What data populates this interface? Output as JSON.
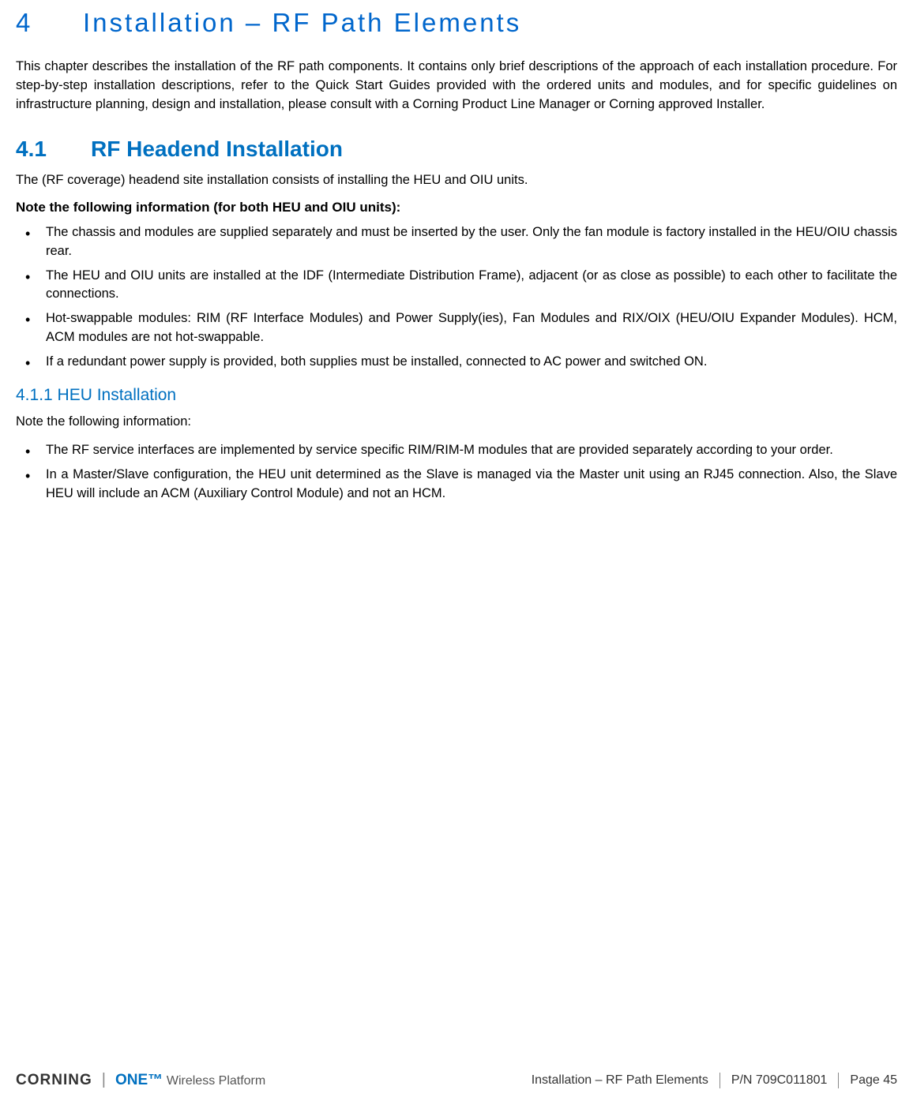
{
  "chapter": {
    "number": "4",
    "title": "Installation – RF Path Elements"
  },
  "intro": "This chapter describes the installation of the RF path components. It contains only brief descriptions of the approach of each installation procedure.   For step-by-step installation descriptions, refer to the Quick Start Guides provided with the ordered units and modules, and for specific guidelines on infrastructure planning, design and installation, please consult with a Corning Product Line Manager or Corning approved Installer.",
  "section41": {
    "number": "4.1",
    "title": "RF Headend Installation",
    "lead": "The (RF coverage) headend site installation consists of installing the HEU and OIU units.",
    "note_heading": "Note the following information (for both HEU and OIU units):",
    "bullets": [
      "The chassis and modules are supplied separately and must be inserted by the user. Only the fan module is factory installed in the HEU/OIU chassis rear.",
      "The HEU and OIU units are installed at the IDF (Intermediate Distribution Frame), adjacent (or as close as possible) to each other to facilitate the connections.",
      "Hot-swappable modules: RIM (RF Interface Modules) and Power Supply(ies), Fan Modules and RIX/OIX   (HEU/OIU Expander Modules). HCM, ACM modules are not hot-swappable.",
      "If a redundant power supply is provided, both supplies must be installed, connected to AC power and switched ON."
    ]
  },
  "section411": {
    "number_title": "4.1.1 HEU Installation",
    "lead": "Note the following information:",
    "bullets": [
      "The RF service interfaces are implemented by service specific RIM/RIM-M modules that are provided separately according to your order.",
      "In a Master/Slave configuration, the HEU unit determined as the Slave is managed via the Master unit using an RJ45 connection. Also, the Slave HEU will include an ACM (Auxiliary Control Module) and not an HCM."
    ]
  },
  "footer": {
    "brand_corning": "CORNING",
    "brand_one": "ONE™",
    "brand_tag": "Wireless Platform",
    "section_ref": "Installation – RF Path Elements",
    "pn": "P/N 709C011801",
    "page": "Page 45"
  }
}
